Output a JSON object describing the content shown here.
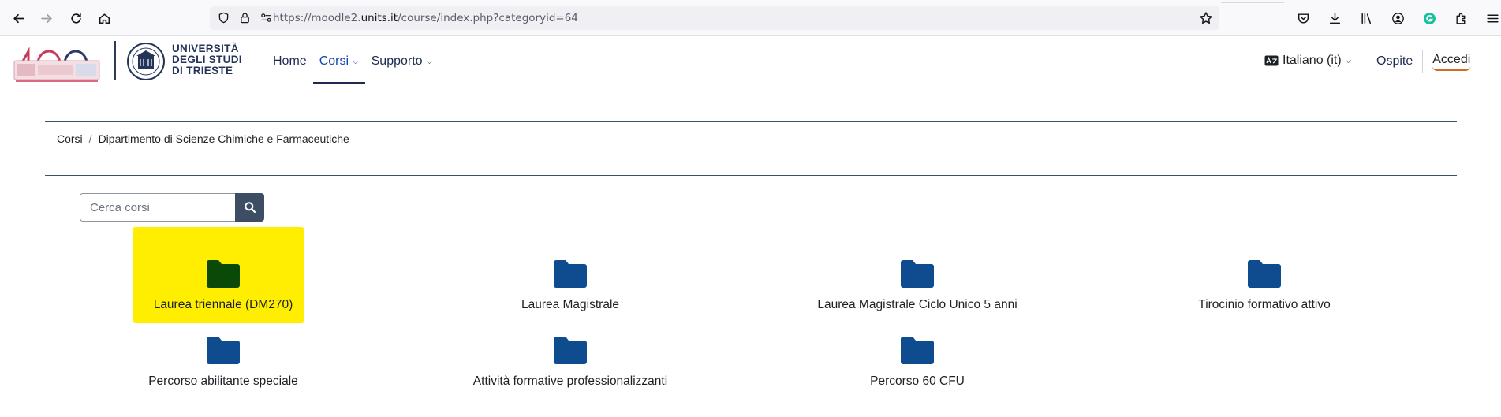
{
  "browser": {
    "url_prefix": "https://moodle2.",
    "url_host": "units.it",
    "url_path": "/course/index.php?categoryid=64"
  },
  "header": {
    "logo_lines": [
      "UNIVERSITÀ",
      "DEGLI STUDI",
      "DI TRIESTE"
    ],
    "nav": [
      {
        "label": "Home",
        "has_menu": false,
        "active": false
      },
      {
        "label": "Corsi",
        "has_menu": true,
        "active": true
      },
      {
        "label": "Supporto",
        "has_menu": true,
        "active": false
      }
    ],
    "language": "Italiano (it)",
    "guest_label": "Ospite",
    "login_label": "Accedi"
  },
  "breadcrumb": [
    "Corsi",
    "Dipartimento di Scienze Chimiche e Farmaceutiche"
  ],
  "search": {
    "placeholder": "Cerca corsi"
  },
  "categories": [
    {
      "label": "Laurea triennale (DM270)",
      "highlighted": true
    },
    {
      "label": "Laurea Magistrale",
      "highlighted": false
    },
    {
      "label": "Laurea Magistrale Ciclo Unico 5 anni",
      "highlighted": false
    },
    {
      "label": "Tirocinio formativo attivo",
      "highlighted": false
    },
    {
      "label": "Percorso abilitante speciale",
      "highlighted": false
    },
    {
      "label": "Attività formative professionalizzanti",
      "highlighted": false
    },
    {
      "label": "Percorso 60 CFU",
      "highlighted": false
    }
  ],
  "colors": {
    "folder": "#0f4b8f",
    "folder_highlighted": "#0b4a06",
    "highlight": "#ffee00",
    "accent_underline": "#d16b1f"
  }
}
